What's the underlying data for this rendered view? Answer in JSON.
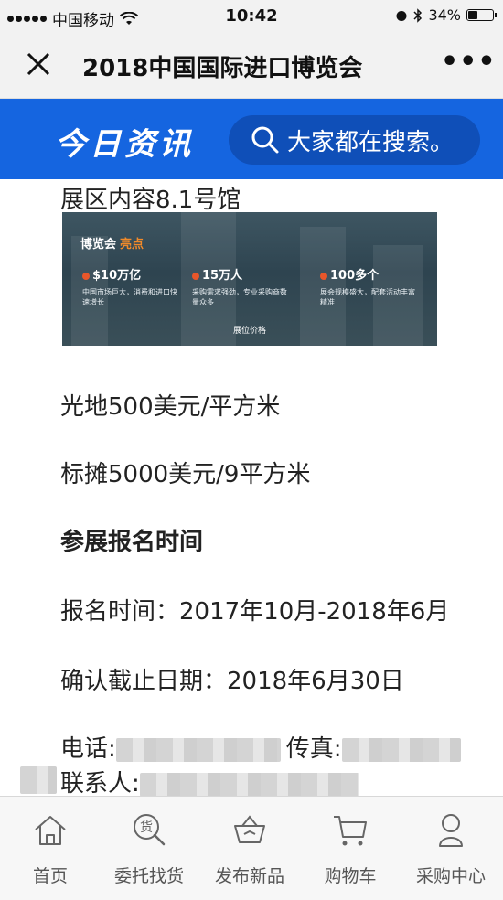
{
  "status_bar": {
    "carrier": "中国移动",
    "time": "10:42",
    "battery": "34%",
    "battery_level": 0.34
  },
  "title_bar": {
    "title": "2018中国国际进口博览会",
    "more_label": "•••"
  },
  "header": {
    "brand": "今日资讯",
    "search_placeholder": "大家都在搜索。",
    "brand_color": "#1565e0"
  },
  "article": {
    "hall_title": "展区内容8.1号馆",
    "banner": {
      "title": "博览会",
      "title_highlight": "亮点",
      "stats": [
        {
          "value": "$10万亿",
          "desc": "中国市场巨大，消费和进口快速增长"
        },
        {
          "value": "15万人",
          "desc": "采购需求强劲，专业采购商数量众多"
        },
        {
          "value": "100多个",
          "desc": "展会规模盛大，配套活动丰富精准"
        }
      ],
      "bottom_label": "展位价格"
    },
    "price_raw": "光地500美元/平方米",
    "price_booth": "标摊5000美元/9平方米",
    "section_heading": "参展报名时间",
    "register_time": "报名时间：2017年10月-2018年6月",
    "deadline": "确认截止日期：2018年6月30日",
    "phone_label": "电话:",
    "fax_label": "传真:",
    "contact_label": "联系人:"
  },
  "bottom_nav": {
    "items": [
      {
        "label": "首页",
        "icon": "home-icon"
      },
      {
        "label": "委托找货",
        "icon": "search-goods-icon"
      },
      {
        "label": "发布新品",
        "icon": "basket-icon"
      },
      {
        "label": "购物车",
        "icon": "cart-icon"
      },
      {
        "label": "采购中心",
        "icon": "user-icon"
      }
    ]
  }
}
